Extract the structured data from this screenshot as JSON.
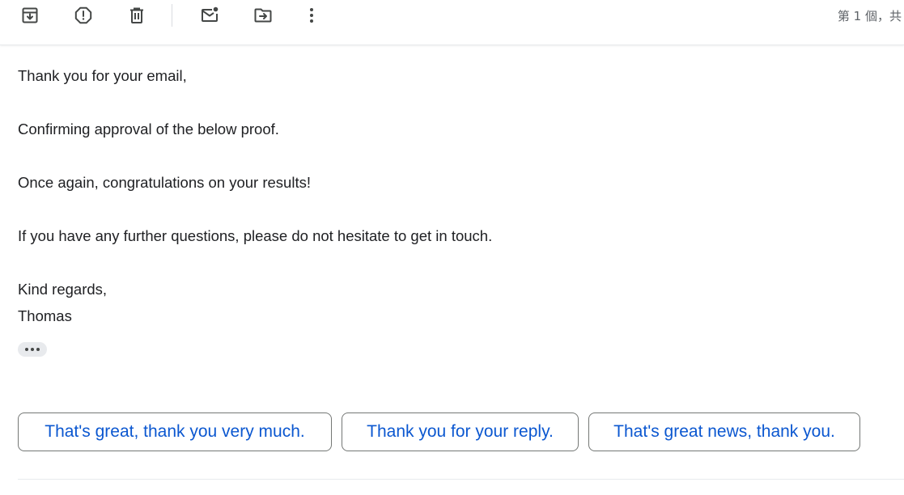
{
  "toolbar": {
    "icons": [
      "archive-icon",
      "report-spam-icon",
      "delete-icon",
      "mark-unread-icon",
      "move-to-icon",
      "more-vert-icon"
    ],
    "pager_text": "第 1 個，共"
  },
  "email": {
    "lines": {
      "greeting": "Thank you for your email,",
      "line1": "Confirming approval of the below proof.",
      "line2": "Once again, congratulations on your results!",
      "line3": "If you have any further questions, please do not hesitate to get in touch.",
      "closing": "Kind regards,",
      "signature": "Thomas"
    }
  },
  "smart_replies": [
    {
      "label": "That's great, thank you very much."
    },
    {
      "label": "Thank you for your reply."
    },
    {
      "label": "That's great news, thank you."
    }
  ],
  "colors": {
    "accent": "#0b57d0",
    "icon": "#444746",
    "text": "#202124"
  }
}
